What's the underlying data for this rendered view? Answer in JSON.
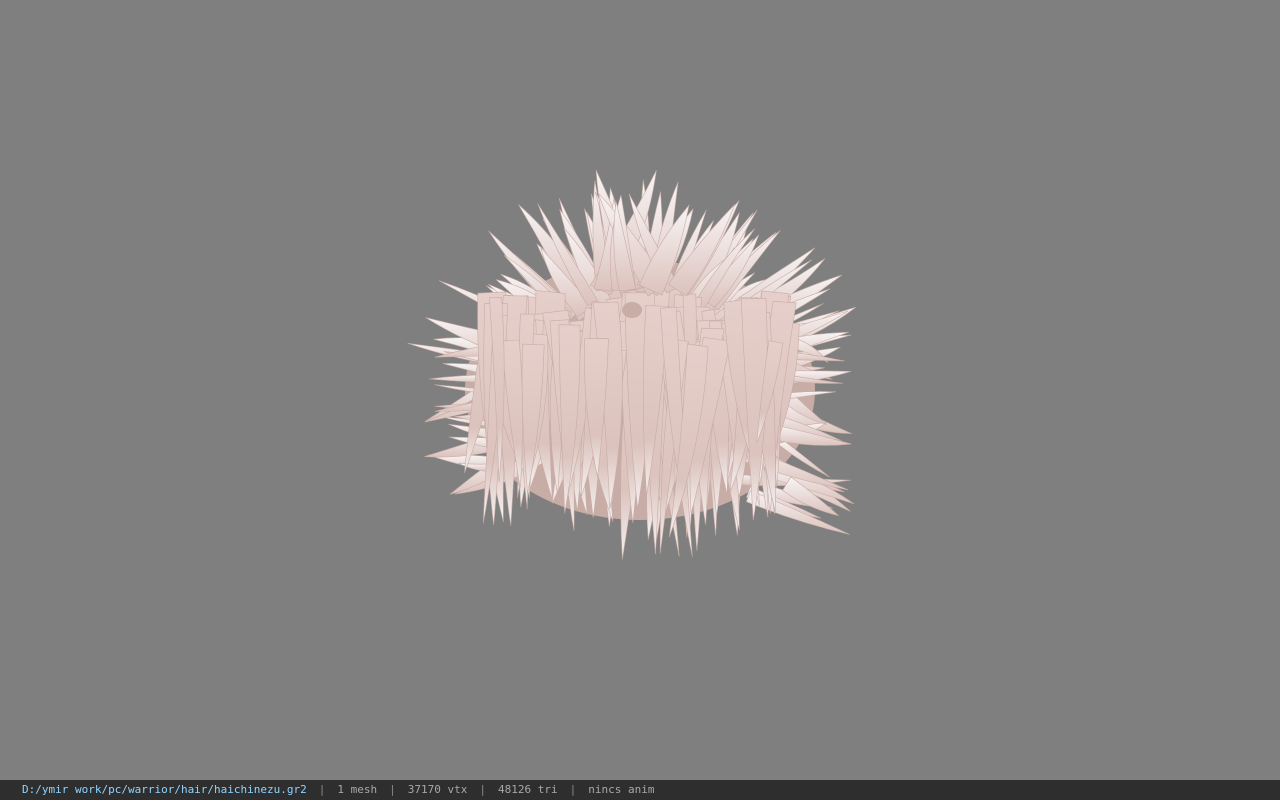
{
  "viewport": {
    "background_color": "#7f7f7f",
    "model": {
      "icon": "hair-model-icon",
      "base_color": "#e7d2cd",
      "shade_color": "#c8aca6",
      "tip_color": "#f4f1f1"
    }
  },
  "status_bar": {
    "file_path": "D:/ymir work/pc/warrior/hair/haichinezu.gr2",
    "separator": "|",
    "mesh_count": "1 mesh",
    "vertex_count": "37170 vtx",
    "triangle_count": "48126 tri",
    "anim_status": "nincs anim",
    "path_color": "#8fd3ff",
    "background_color": "#2e2e2e"
  }
}
